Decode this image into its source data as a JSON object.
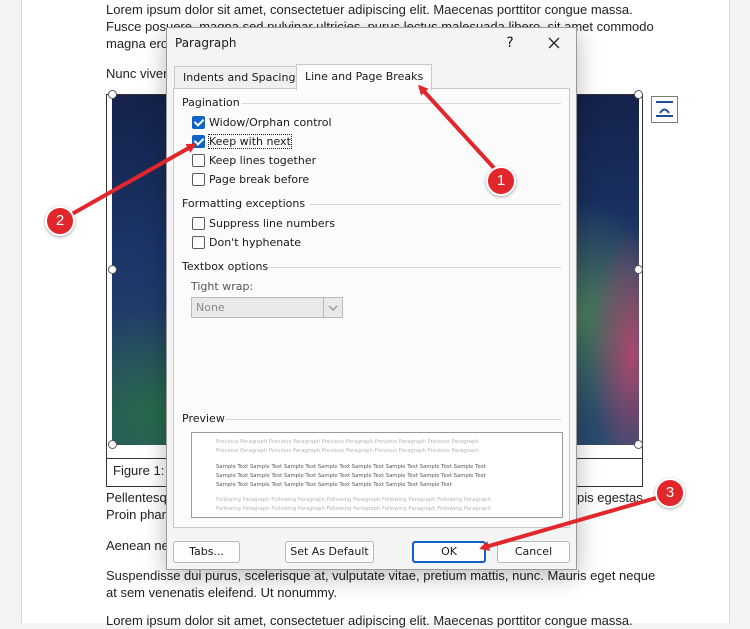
{
  "document": {
    "lines": [
      "Lorem ipsum dolor sit amet, consectetuer adipiscing elit. Maecenas porttitor congue massa.",
      "Fusce posuere, magna sed pulvinar ultricies, purus lectus malesuada libero, sit amet commodo",
      "magna eros",
      "Nunc viver",
      "Pellentesq",
      "Proin phar",
      "Aenean ne",
      "Suspendisse dui purus, scelerisque at, vulputate vitae, pretium mattis, nunc. Mauris eget neque",
      "at sem venenatis eleifend. Ut nonummy.",
      "Lorem ipsum dolor sit amet, consectetuer adipiscing elit. Maecenas porttitor congue massa."
    ],
    "right_fragment_pellentesque": "pis egestas.",
    "caption": "Figure 1: I"
  },
  "dialog": {
    "title": "Paragraph",
    "help": "?",
    "tabs": [
      {
        "label": "Indents and Spacing",
        "active": false
      },
      {
        "label": "Line and Page Breaks",
        "active": true
      }
    ],
    "pagination": {
      "heading": "Pagination",
      "options": [
        {
          "label": "Widow/Orphan control",
          "checked": true
        },
        {
          "label": "Keep with next",
          "checked": true
        },
        {
          "label": "Keep lines together",
          "checked": false
        },
        {
          "label": "Page break before",
          "checked": false
        }
      ]
    },
    "formatting_exceptions": {
      "heading": "Formatting exceptions",
      "options": [
        {
          "label": "Suppress line numbers",
          "checked": false
        },
        {
          "label": "Don't hyphenate",
          "checked": false
        }
      ]
    },
    "textbox_options": {
      "heading": "Textbox options",
      "tight_wrap_label": "Tight wrap:",
      "tight_wrap_value": "None"
    },
    "preview": {
      "heading": "Preview",
      "previous": "Previous Paragraph Previous Paragraph Previous Paragraph Previous Paragraph Previous Paragraph",
      "sample": "Sample Text Sample Text Sample Text Sample Text Sample Text Sample Text Sample Text Sample Text",
      "sample_end": "Sample Text Sample Text Sample Text Sample Text Sample Text Sample Text Sample Text",
      "following": "Following Paragraph Following Paragraph Following Paragraph Following Paragraph Following Paragraph"
    },
    "buttons": {
      "tabs": "Tabs...",
      "set_default": "Set As Default",
      "ok": "OK",
      "cancel": "Cancel"
    }
  },
  "callouts": [
    "1",
    "2",
    "3"
  ],
  "colors": {
    "accent": "#0f62c6",
    "callout": "#e2272c"
  }
}
